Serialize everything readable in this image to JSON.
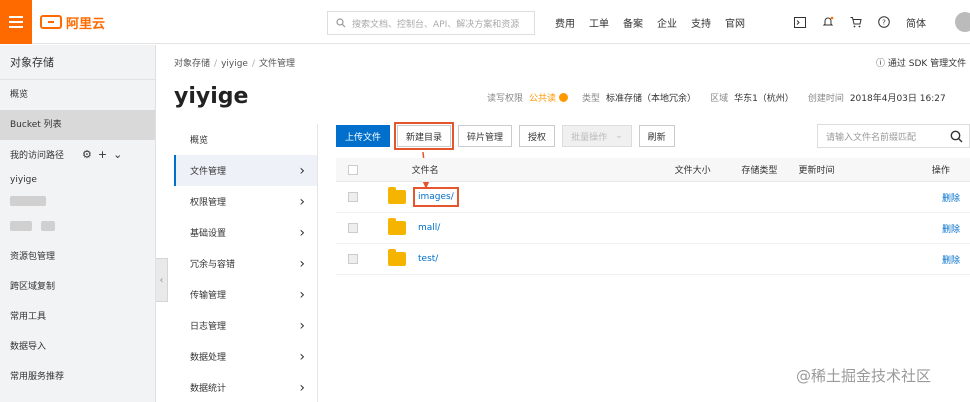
{
  "topbar": {
    "brand": "阿里云",
    "search_placeholder": "搜索文档、控制台、API、解决方案和资源",
    "nav": [
      "费用",
      "工单",
      "备案",
      "企业",
      "支持",
      "官网"
    ],
    "lang": "简体"
  },
  "sidebar": {
    "title": "对象存储",
    "overview": "概览",
    "bucket_list": "Bucket 列表",
    "recent": "我的访问路径",
    "bucket_name": "yiyige",
    "items": [
      "资源包管理",
      "跨区域复制",
      "常用工具",
      "数据导入",
      "常用服务推荐"
    ]
  },
  "breadcrumb": [
    "对象存储",
    "yiyige",
    "文件管理"
  ],
  "sdk_link": "通过 SDK 管理文件",
  "bucket": {
    "name": "yiyige",
    "acl_label": "读写权限",
    "acl_value": "公共读",
    "type_label": "类型",
    "type_value": "标准存储（本地冗余）",
    "region_label": "区域",
    "region_value": "华东1（杭州）",
    "created_label": "创建时间",
    "created_value": "2018年4月03日 16:27"
  },
  "submenu": [
    "概览",
    "文件管理",
    "权限管理",
    "基础设置",
    "冗余与容错",
    "传输管理",
    "日志管理",
    "数据处理",
    "数据统计"
  ],
  "toolbar": {
    "upload": "上传文件",
    "new_dir": "新建目录",
    "fragments": "碎片管理",
    "authorize": "授权",
    "batch": "批量操作",
    "refresh": "刷新",
    "filter_placeholder": "请输入文件名前缀匹配"
  },
  "table": {
    "headers": [
      "文件名",
      "文件大小",
      "存储类型",
      "更新时间",
      "操作"
    ],
    "rows": [
      {
        "name": "images/",
        "action": "删除"
      },
      {
        "name": "mall/",
        "action": "删除"
      },
      {
        "name": "test/",
        "action": "删除"
      }
    ]
  },
  "watermark": "@稀土掘金技术社区",
  "colors": {
    "accent": "#ff6a00",
    "link": "#0070cc",
    "highlight": "#e4572e",
    "folder": "#f5b400"
  }
}
